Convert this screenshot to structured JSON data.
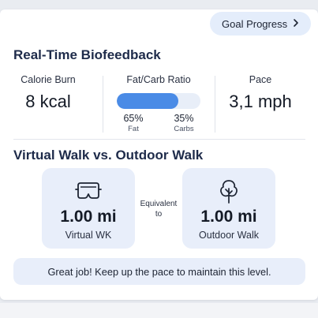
{
  "header": {
    "goal_button_label": "Goal Progress"
  },
  "biofeedback": {
    "title": "Real-Time Biofeedback",
    "calorie": {
      "label": "Calorie Burn",
      "value": "8 kcal"
    },
    "ratio": {
      "label": "Fat/Carb Ratio",
      "fat_percent": "65%",
      "fat_label": "Fat",
      "carb_percent": "35%",
      "carb_label": "Carbs",
      "fat_fraction": 0.74
    },
    "pace": {
      "label": "Pace",
      "value": "3,1 mph"
    }
  },
  "walk": {
    "title": "Virtual Walk vs. Outdoor Walk",
    "virtual": {
      "value": "1.00 mi",
      "label": "Virtual WK",
      "icon": "vr-headset-icon"
    },
    "equivalent_line1": "Equivalent",
    "equivalent_line2": "to",
    "outdoor": {
      "value": "1.00 mi",
      "label": "Outdoor Walk",
      "icon": "tree-icon"
    }
  },
  "message": "Great job! Keep up the pace to maintain this level.",
  "colors": {
    "accent": "#4a8be6",
    "card_tint": "#e8eefa",
    "title": "#1e2b4a"
  }
}
